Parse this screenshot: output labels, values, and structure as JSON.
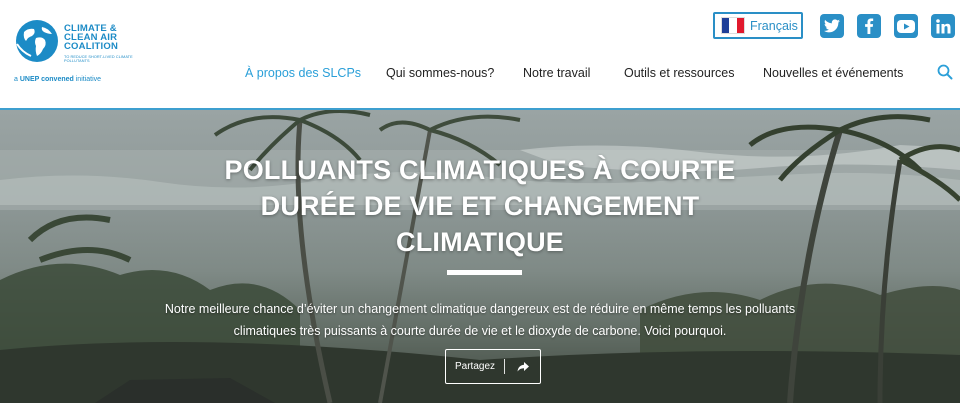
{
  "logo": {
    "line1": "CLIMATE &",
    "line2": "CLEAN AIR",
    "line3": "COALITION",
    "tagline": "TO REDUCE SHORT-LIVED CLIMATE POLLUTANTS",
    "unep_prefix": "a ",
    "unep_bold": "UNEP convened",
    "unep_suffix": " initiative"
  },
  "language": {
    "label": "Français",
    "flag_colors": [
      "#1f3f98",
      "#ffffff",
      "#e1192d"
    ]
  },
  "social": [
    {
      "icon": "twitter-icon"
    },
    {
      "icon": "facebook-icon"
    },
    {
      "icon": "youtube-icon"
    },
    {
      "icon": "linkedin-icon"
    }
  ],
  "nav": {
    "items": [
      {
        "label": "À propos des SLCPs",
        "active": true
      },
      {
        "label": "Qui sommes-nous?"
      },
      {
        "label": "Notre travail"
      },
      {
        "label": "Outils et ressources"
      },
      {
        "label": "Nouvelles et événements"
      }
    ]
  },
  "hero": {
    "title": "POLLUANTS CLIMATIQUES À COURTE DURÉE DE VIE ET CHANGEMENT CLIMATIQUE",
    "subtitle": "Notre meilleure chance d’éviter un changement climatique dangereux est de réduire en même temps les polluants climatiques très puissants à courte durée de vie et le dioxyde de carbone. Voici pourquoi.",
    "share_label": "Partagez",
    "share_icon": "share-arrow-icon"
  },
  "colors": {
    "accent": "#2a8fc6",
    "active_nav": "#2a9fd8",
    "header_border": "#3d9fcf"
  }
}
